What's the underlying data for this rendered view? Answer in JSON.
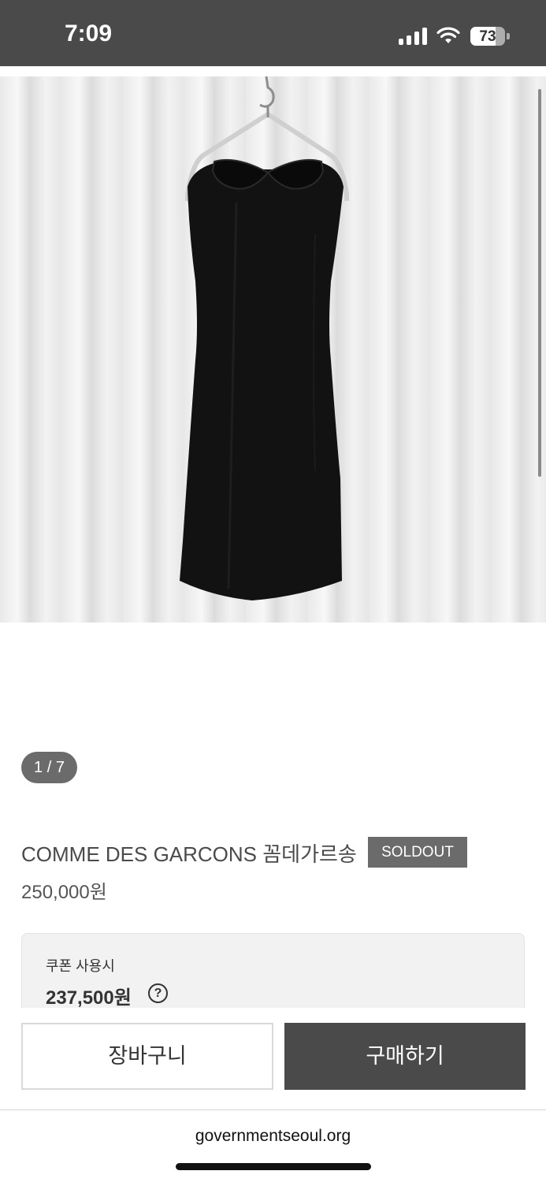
{
  "status_bar": {
    "time": "7:09",
    "battery_level": "73",
    "signal_icon": "cellular-signal-icon",
    "wifi_icon": "wifi-icon",
    "battery_icon": "battery-icon"
  },
  "gallery": {
    "image_description": "black sleeveless dress with round collar on hanger",
    "page_indicator": "1 / 7"
  },
  "product": {
    "title": "COMME DES GARCONS 꼼데가르송",
    "badge": "SOLDOUT",
    "price": "250,000원"
  },
  "coupon": {
    "label": "쿠폰 사용시",
    "price": "237,500원",
    "help_icon": "?"
  },
  "actions": {
    "cart_label": "장바구니",
    "buy_label": "구매하기"
  },
  "browser": {
    "url": "governmentseoul.org"
  },
  "colors": {
    "status_bar_bg": "#4a4a4a",
    "badge_bg": "#6b6b6b",
    "buy_button_bg": "#4a4a4a",
    "coupon_bg": "#f2f2f2"
  }
}
